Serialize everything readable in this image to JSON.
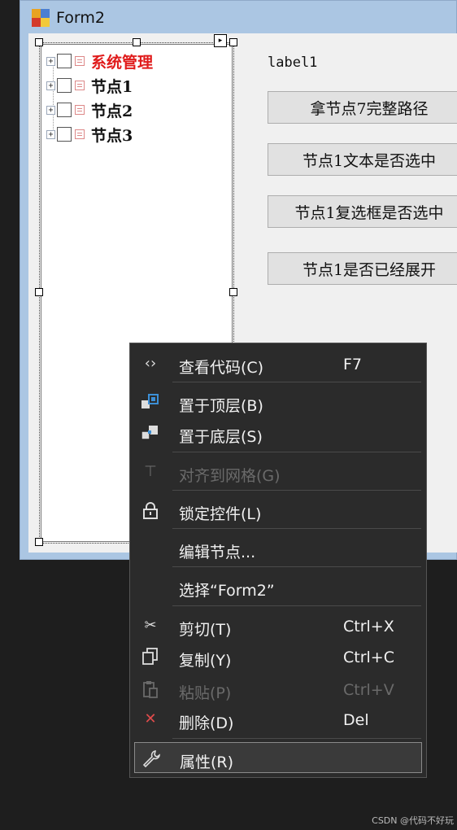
{
  "window": {
    "title": "Form2"
  },
  "tree": {
    "nodes": [
      {
        "label": "系统管理",
        "color": "#e01b1b",
        "expander": "+"
      },
      {
        "label": "节点1",
        "expander": "+"
      },
      {
        "label": "节点2",
        "expander": "+"
      },
      {
        "label": "节点3",
        "expander": "+"
      }
    ],
    "smart_tag_glyph": "▸"
  },
  "form": {
    "label": "label1",
    "buttons": [
      "拿节点7完整路径",
      "节点1文本是否选中",
      "节点1复选框是否选中",
      "节点1是否已经展开"
    ]
  },
  "context_menu": {
    "items": [
      {
        "label": "查看代码(C)",
        "shortcut": "F7",
        "icon": "code-icon",
        "glyph": "‹›"
      },
      {
        "label": "置于顶层(B)",
        "icon": "bring-to-front-icon"
      },
      {
        "label": "置于底层(S)",
        "icon": "send-to-back-icon"
      },
      {
        "label": "对齐到网格(G)",
        "icon": "align-to-grid-icon",
        "disabled": true,
        "glyph": "⊤"
      },
      {
        "label": "锁定控件(L)",
        "icon": "lock-icon"
      },
      {
        "label": "编辑节点..."
      },
      {
        "label": "选择“Form2”"
      },
      {
        "label": "剪切(T)",
        "shortcut": "Ctrl+X",
        "icon": "scissors-icon",
        "glyph": "✂"
      },
      {
        "label": "复制(Y)",
        "shortcut": "Ctrl+C",
        "icon": "copy-icon"
      },
      {
        "label": "粘贴(P)",
        "shortcut": "Ctrl+V",
        "icon": "paste-icon",
        "disabled": true
      },
      {
        "label": "删除(D)",
        "shortcut": "Del",
        "icon": "delete-icon",
        "glyph": "✕",
        "glyph_color": "#e04b4b"
      },
      {
        "label": "属性(R)",
        "icon": "wrench-icon",
        "highlighted": true,
        "glyph": "🔧"
      }
    ]
  },
  "watermark": "CSDN @代码不好玩"
}
